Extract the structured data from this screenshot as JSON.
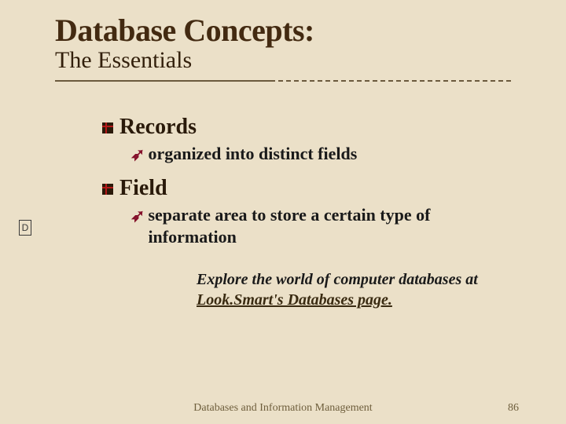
{
  "title": "Database Concepts:",
  "subtitle": "The Essentials",
  "bullets": [
    {
      "label": "Records",
      "sub": "organized into distinct fields"
    },
    {
      "label": "Field",
      "sub": "separate area to store a certain type of information"
    }
  ],
  "explore": {
    "prefix": "Explore the world of computer databases at ",
    "link": "Look.Smart's Databases page."
  },
  "footer": "Databases and Information Management",
  "page_number": "86",
  "side_marker": "D"
}
